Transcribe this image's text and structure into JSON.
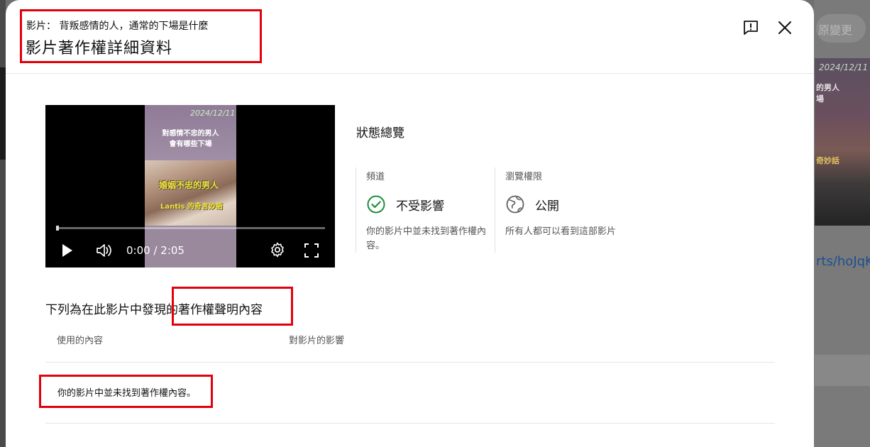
{
  "background": {
    "pill_text": "原變更",
    "thumb_date": "2024/12/11",
    "thumb_line1": "的男人",
    "thumb_line2": "場",
    "thumb_line3": "奇妙話",
    "link_text": "rts/hoJqK"
  },
  "header": {
    "video_subtitle": "影片： 背叛感情的人，通常的下場是什麼",
    "title": "影片著作權詳細資料"
  },
  "video": {
    "thumb_date": "2024/12/11",
    "thumb_headline_1": "對感情不忠的男人",
    "thumb_headline_2": "會有哪些下場",
    "thumb_overlay_1": "婚姻不忠的男人",
    "thumb_overlay_2": "Lantis 的奇言妙語",
    "time": "0:00 / 2:05",
    "progress": 0
  },
  "status": {
    "title": "狀態總覽",
    "channel": {
      "label": "頻道",
      "value": "不受影響",
      "description": "你的影片中並未找到著作權內容。"
    },
    "visibility": {
      "label": "瀏覽權限",
      "value": "公開",
      "description": "所有人都可以看到這部影片"
    }
  },
  "claims": {
    "title": "下列為在此影片中發現的著作權聲明內容",
    "col_content": "使用的內容",
    "col_impact": "對影片的影響",
    "empty_message": "你的影片中並未找到著作權內容。"
  },
  "colors": {
    "highlight": "#e3000b",
    "check_green": "#1e8e3e"
  }
}
